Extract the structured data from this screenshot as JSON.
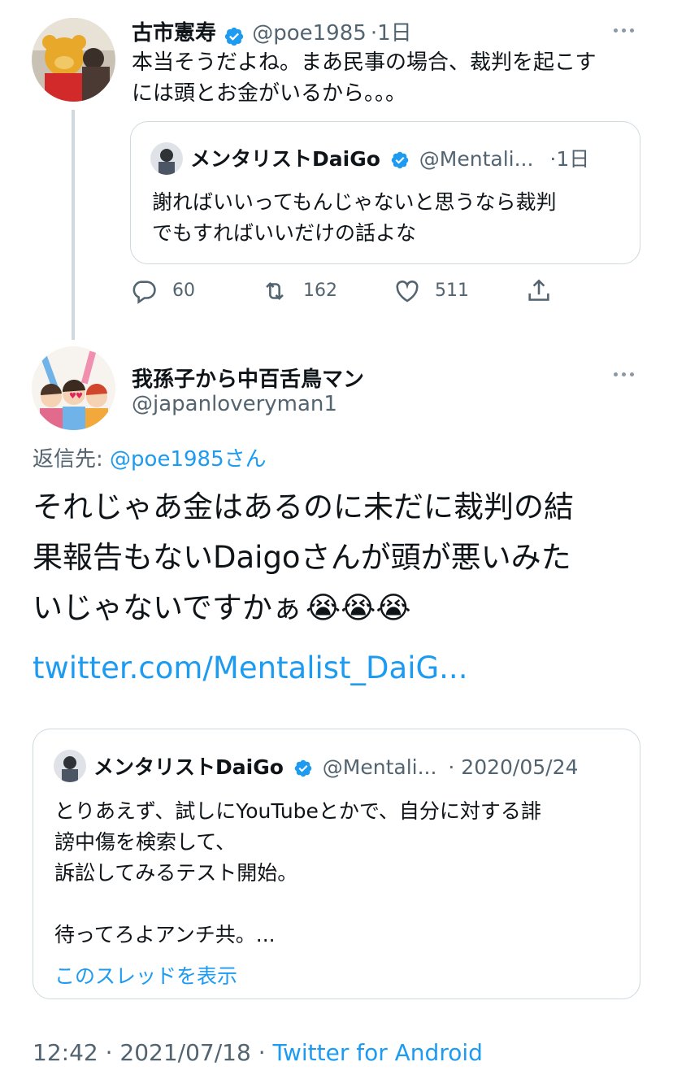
{
  "tweet1": {
    "name": "古市憲寿",
    "handle": "@poe1985",
    "time": "·1日",
    "text_lines": [
      "本当そうだよね。まあ民事の場合、裁判を起こす",
      "には頭とお金がいるから。。。"
    ],
    "quote": {
      "name": "メンタリストDaiGo",
      "handle": "@Mentali...",
      "time": "·1日",
      "text_lines": [
        "謝ればいいってもんじゃないと思うなら裁判",
        "でもすればいいだけの話よな"
      ]
    },
    "actions": {
      "replies": "60",
      "retweets": "162",
      "likes": "511"
    }
  },
  "tweet2": {
    "name": "我孫子から中百舌鳥マン",
    "handle": "@japanloveryman1",
    "reply_prefix": "返信先: ",
    "reply_to": "@poe1985さん",
    "text_lines": [
      "それじゃあ金はあるのに未だに裁判の結",
      "果報告もないDaigoさんが頭が悪いみた",
      "いじゃないですかぁ"
    ],
    "emoji": "😭😭😭",
    "link": "twitter.com/Mentalist_DaiG...",
    "quote": {
      "name": "メンタリストDaiGo",
      "handle": "@Mentali...",
      "time": "· 2020/05/24",
      "text_lines": [
        "とりあえず、試しにYouTubeとかで、自分に対する誹",
        "謗中傷を検索して、",
        "訴訟してみるテスト開始。",
        "",
        "待ってろよアンチ共。..."
      ],
      "show_thread": "このスレッドを表示"
    },
    "meta": {
      "time": "12:42",
      "sep1": " · ",
      "date": "2021/07/18",
      "sep2": " · ",
      "client": "Twitter for Android"
    }
  },
  "colors": {
    "accent": "#1d9bf0",
    "muted": "#536471",
    "border": "#cfd9de"
  },
  "icons": [
    "verified-badge-icon",
    "more-icon",
    "reply-icon",
    "retweet-icon",
    "like-icon",
    "share-icon"
  ]
}
